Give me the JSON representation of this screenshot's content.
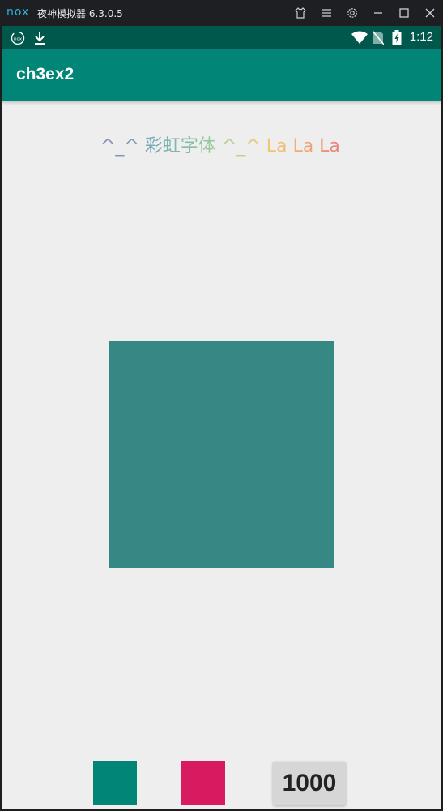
{
  "emulator": {
    "logo": "nox",
    "title": "夜神模拟器 6.3.0.5",
    "controls": [
      "shirt-icon",
      "menu-icon",
      "settings-icon",
      "minimize-icon",
      "maximize-icon",
      "close-icon"
    ]
  },
  "statusbar": {
    "left_icons": [
      "nox-app-icon",
      "download-icon"
    ],
    "right_icons": [
      "wifi-icon",
      "no-sim-icon",
      "battery-charging-icon"
    ],
    "time": "1:12",
    "color": "#00574b"
  },
  "appbar": {
    "title": "ch3ex2",
    "color": "#008577"
  },
  "main": {
    "rainbow_text": "^_^ 彩虹字体 ^_^ La La La ~",
    "square_color": "#358883"
  },
  "buttons": {
    "teal_color": "#008577",
    "pink_color": "#d81b60",
    "count_label": "1000"
  }
}
